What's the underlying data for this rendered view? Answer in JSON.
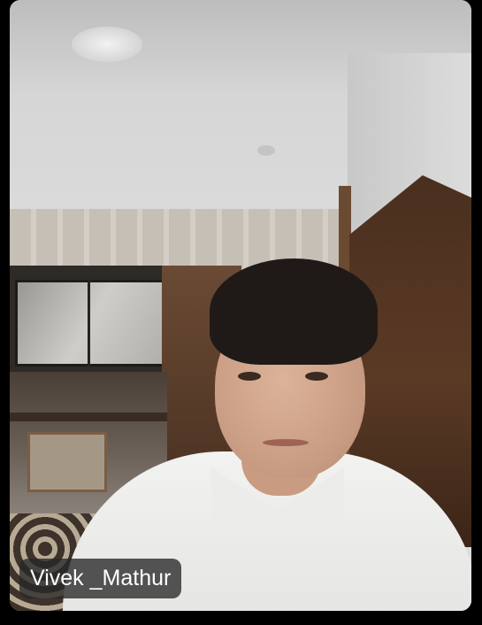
{
  "participant": {
    "name": "Vivek _Mathur"
  },
  "tile": {
    "label_background": "#2b2b2b",
    "label_text_color": "#ffffff"
  }
}
